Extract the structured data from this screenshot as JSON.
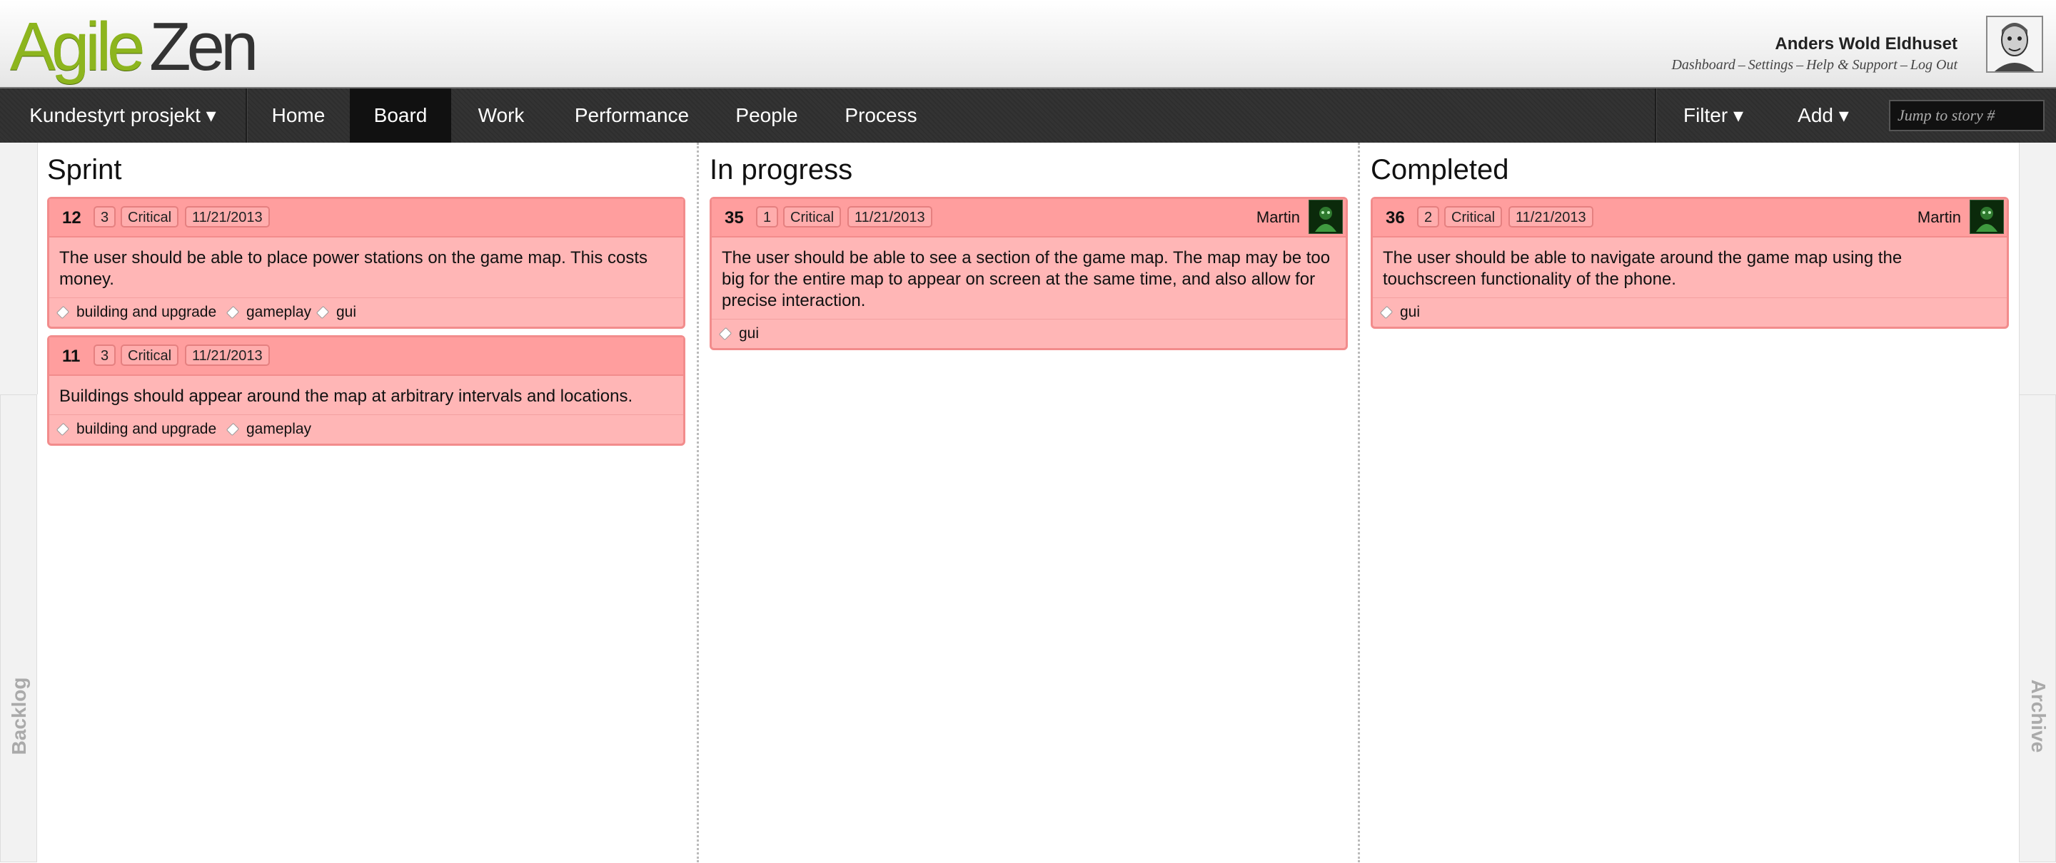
{
  "app": {
    "logo_part1": "Agile",
    "logo_part2": "Zen"
  },
  "user": {
    "name": "Anders Wold Eldhuset",
    "links": [
      "Dashboard",
      "Settings",
      "Help & Support",
      "Log Out"
    ],
    "link_separator": "–"
  },
  "nav": {
    "project": "Kundestyrt prosjekt ▾",
    "items": [
      "Home",
      "Board",
      "Work",
      "Performance",
      "People",
      "Process"
    ],
    "active": "Board",
    "filter": "Filter ▾",
    "add": "Add ▾",
    "jump_placeholder": "Jump to story #"
  },
  "side": {
    "left": "Backlog",
    "right": "Archive"
  },
  "colors": {
    "card_bg": "#ffb6b6",
    "card_head": "#ff9e9e",
    "card_border": "#f28c8c",
    "logo_green": "#8db51e"
  },
  "columns": [
    {
      "title": "Sprint",
      "cards": [
        {
          "number": "12",
          "size": "3",
          "priority": "Critical",
          "date": "11/21/2013",
          "owner": "",
          "text": "The user should be able to place power stations on the game map. This costs money.",
          "tags": [
            "building and upgrade",
            "gameplay",
            "gui"
          ]
        },
        {
          "number": "11",
          "size": "3",
          "priority": "Critical",
          "date": "11/21/2013",
          "owner": "",
          "text": "Buildings should appear around the map at arbitrary intervals and locations.",
          "tags": [
            "building and upgrade",
            "gameplay"
          ]
        }
      ]
    },
    {
      "title": "In progress",
      "cards": [
        {
          "number": "35",
          "size": "1",
          "priority": "Critical",
          "date": "11/21/2013",
          "owner": "Martin",
          "text": "The user should be able to see a section of the game map. The map may be too big for the entire map to appear on screen at the same time, and also allow for precise interaction.",
          "tags": [
            "gui"
          ]
        }
      ]
    },
    {
      "title": "Completed",
      "cards": [
        {
          "number": "36",
          "size": "2",
          "priority": "Critical",
          "date": "11/21/2013",
          "owner": "Martin",
          "text": "The user should be able to navigate around the game map using the touchscreen functionality of the phone.",
          "tags": [
            "gui"
          ]
        }
      ]
    }
  ]
}
